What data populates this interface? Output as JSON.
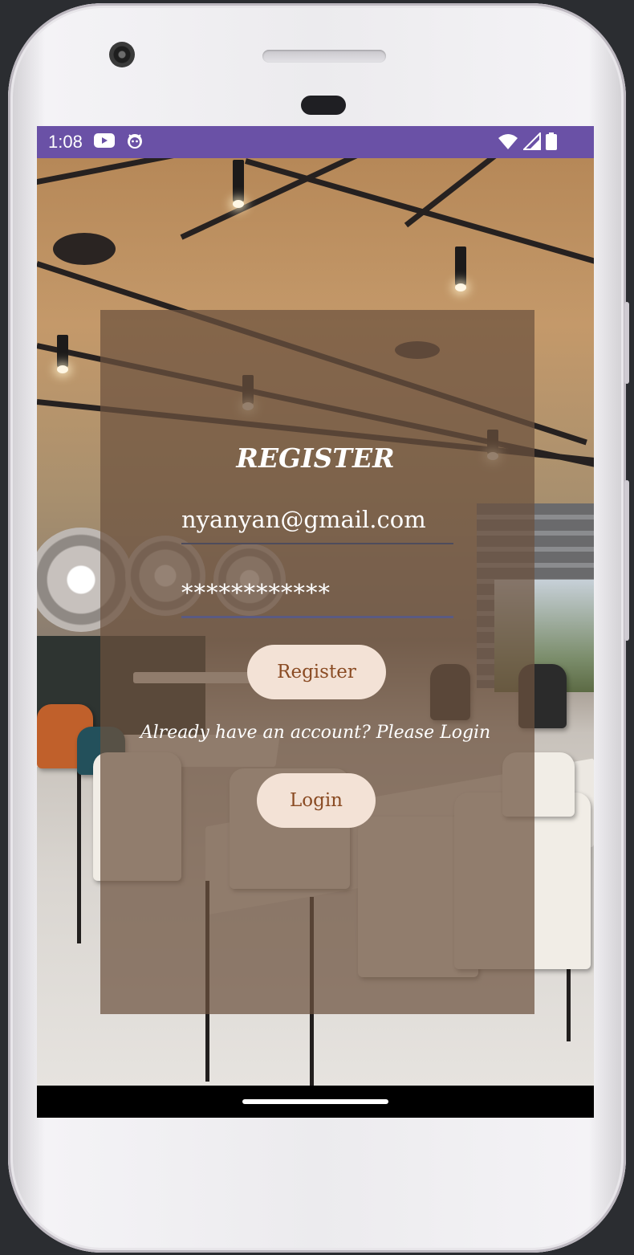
{
  "status_bar": {
    "time": "1:08",
    "left_icons": [
      "youtube-icon",
      "android-face-icon"
    ],
    "right_icons": [
      "wifi-icon",
      "signal-icon",
      "battery-icon"
    ],
    "color": "#6a51a6"
  },
  "form": {
    "title": "REGISTER",
    "email_value": "nyanyan@gmail.com",
    "password_value": "************",
    "register_label": "Register",
    "login_prompt": "Already have an account? Please Login",
    "login_label": "Login"
  },
  "colors": {
    "overlay": "#6c523e",
    "button_bg": "#f3e2d6",
    "button_text": "#8a4b23",
    "status_bar": "#6a51a6"
  }
}
